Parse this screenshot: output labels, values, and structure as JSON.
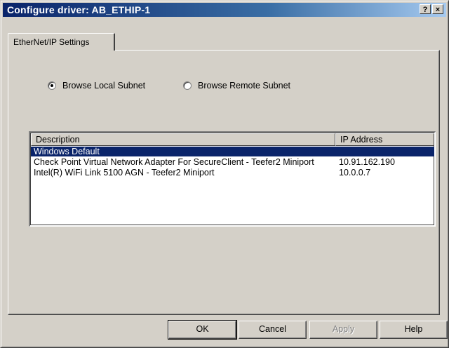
{
  "window": {
    "title": "Configure driver: AB_ETHIP-1",
    "help_glyph": "?",
    "close_glyph": "×"
  },
  "tabs": [
    {
      "label": "EtherNet/IP Settings",
      "active": true
    }
  ],
  "radios": [
    {
      "label": "Browse Local Subnet",
      "checked": true
    },
    {
      "label": "Browse Remote Subnet",
      "checked": false
    }
  ],
  "list": {
    "columns": [
      "Description",
      "IP Address"
    ],
    "rows": [
      {
        "description": "Windows Default",
        "ip": "",
        "selected": true
      },
      {
        "description": "Check Point Virtual Network Adapter For SecureClient - Teefer2 Miniport",
        "ip": "10.91.162.190",
        "selected": false
      },
      {
        "description": "Intel(R) WiFi Link 5100 AGN - Teefer2 Miniport",
        "ip": "10.0.0.7",
        "selected": false
      }
    ]
  },
  "buttons": {
    "ok": "OK",
    "cancel": "Cancel",
    "apply": "Apply",
    "help": "Help"
  },
  "colors": {
    "title_bar": "#0a246a",
    "selection": "#0a246a",
    "face": "#d4d0c8"
  }
}
